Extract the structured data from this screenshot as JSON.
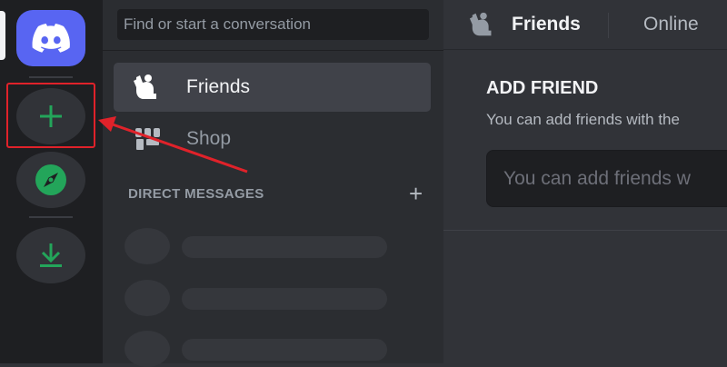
{
  "search": {
    "placeholder": "Find or start a conversation"
  },
  "nav": {
    "friends_label": "Friends",
    "shop_label": "Shop"
  },
  "direct_messages": {
    "header": "DIRECT MESSAGES",
    "add_symbol": "+"
  },
  "topbar": {
    "title": "Friends",
    "tab_online": "Online"
  },
  "add_friend": {
    "title": "ADD FRIEND",
    "description": "You can add friends with the",
    "input_placeholder": "You can add friends w"
  },
  "icons": {
    "home": "discord-logo-icon",
    "add_server": "plus-icon",
    "explore": "compass-icon",
    "download": "download-icon",
    "friends": "friends-wave-icon",
    "shop": "shop-icon"
  },
  "colors": {
    "brand": "#5865f2",
    "green": "#23a55a",
    "annotation": "#e0222a"
  }
}
